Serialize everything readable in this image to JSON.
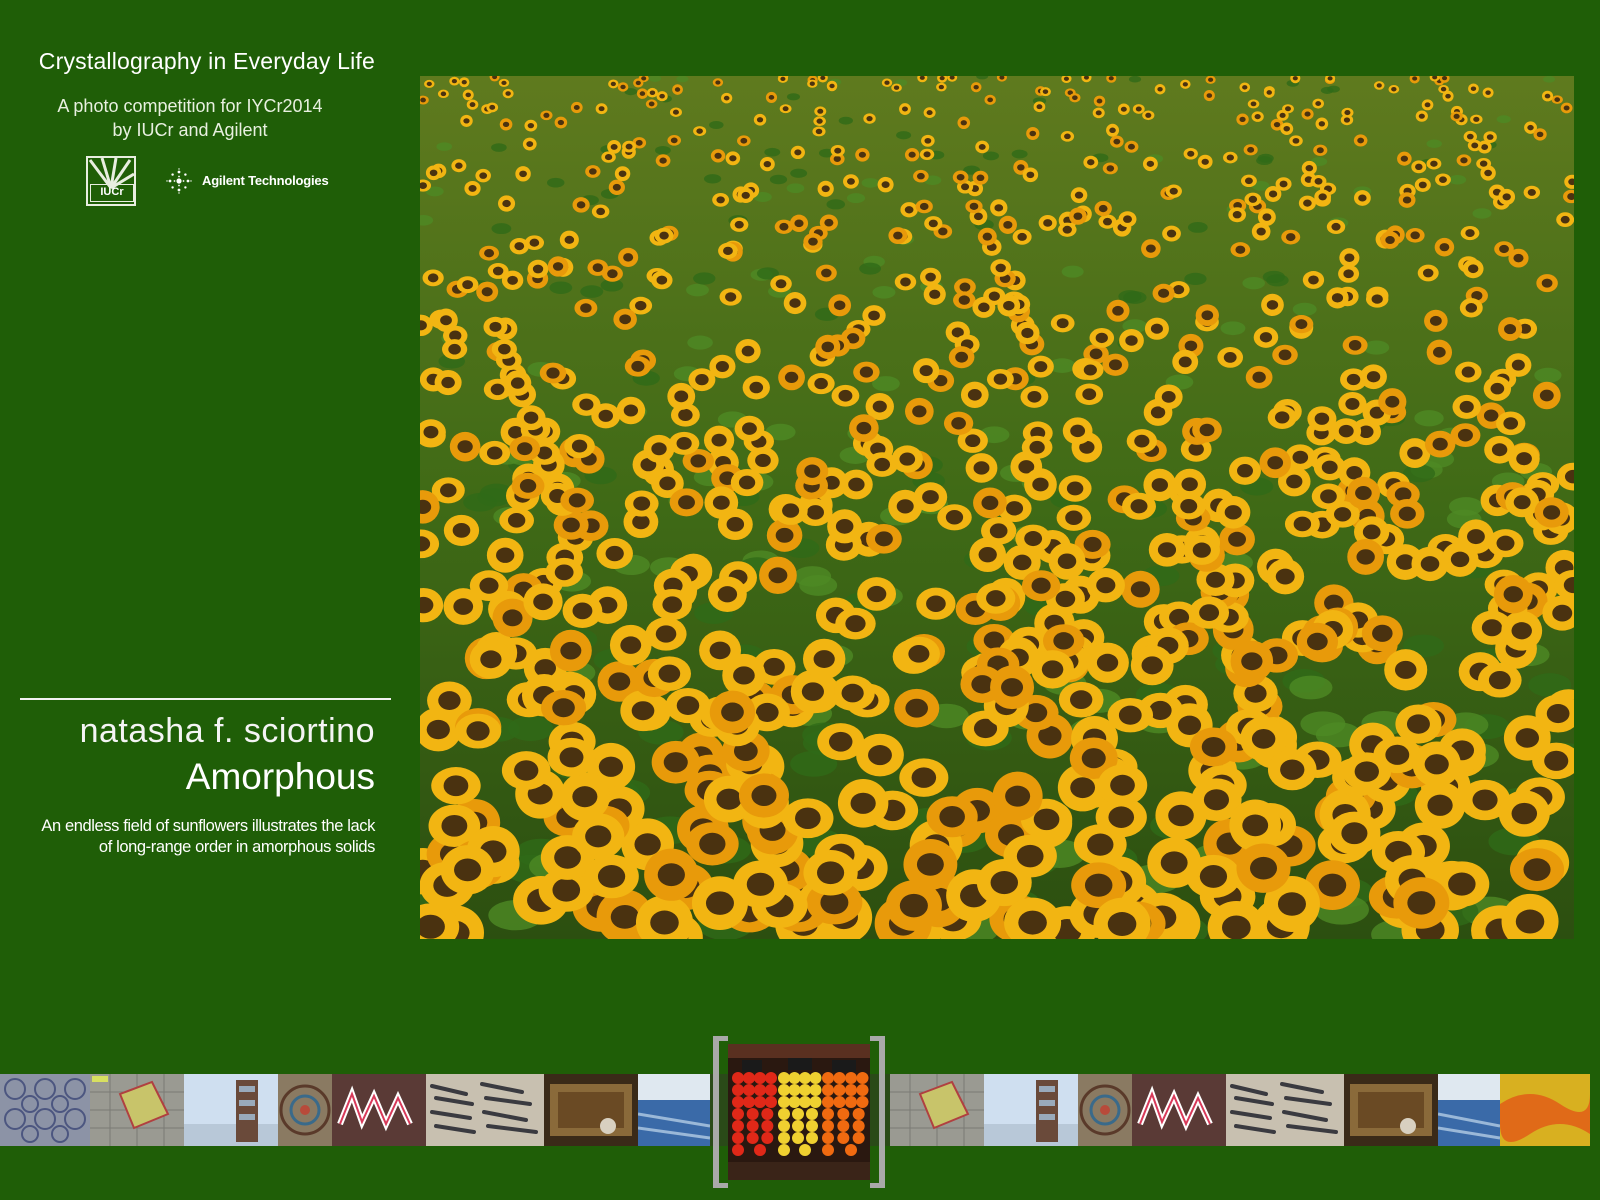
{
  "header": {
    "title": "Crystallography in Everyday Life",
    "subtitle_line1": "A photo competition for IYCr2014",
    "subtitle_line2": "by IUCr and Agilent"
  },
  "logos": {
    "iucr": "IUCr",
    "agilent": "Agilent Technologies"
  },
  "entry": {
    "author": "natasha f. sciortino",
    "title": "Amorphous",
    "description": "An endless field of sunflowers illustrates the lack of long-range order in amorphous solids"
  },
  "colors": {
    "background": "#1f5e07",
    "text": "#ffffff",
    "frame": "#a9a9a9"
  },
  "filmstrip": {
    "thumbnails": [
      "tiled-pattern-photo",
      "paving-stones-photo",
      "tower-photo",
      "round-ornament-photo",
      "graffiti-photo",
      "fish-crate-photo",
      "wooden-boat-photo",
      "blue-harbor-photo",
      "paving-stones-photo",
      "tower-photo",
      "round-ornament-photo",
      "graffiti-photo",
      "fish-crate-photo",
      "wooden-boat-photo",
      "blue-harbor-photo",
      "orange-field-photo"
    ],
    "selected": "fruit-stall-photo"
  }
}
